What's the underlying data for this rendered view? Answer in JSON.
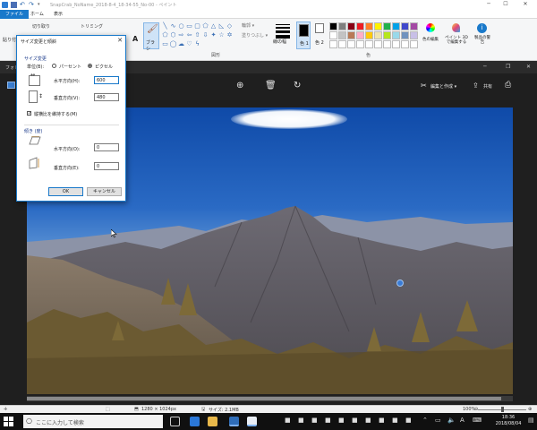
{
  "paint": {
    "title": "SnapCrab_NoName_2018-8-4_18-34-55_No-00 - ペイント",
    "tabs": [
      "ファイル",
      "ホーム",
      "表示"
    ],
    "clipboard_paste": "貼り付",
    "clipboard_cut": "切り取り",
    "image_crop": "トリミング",
    "brush_label": "ブラシ",
    "outline_label": "輪郭",
    "fill_label": "塗りつぶし",
    "size_label": "線の幅",
    "color1_label": "色 1",
    "color2_label": "色 2",
    "edit_colors_label": "色の編集",
    "paint3d_label": "ペイント 3D で編集する",
    "product_alert_label": "製品の警告",
    "group_shapes": "図形",
    "group_colors": "色",
    "palette_colors": [
      "#000000",
      "#7f7f7f",
      "#880015",
      "#ed1c24",
      "#ff7f27",
      "#fff200",
      "#22b14c",
      "#00a2e8",
      "#3f48cc",
      "#a349a4",
      "#ffffff",
      "#c3c3c3",
      "#b97a57",
      "#ffaec9",
      "#ffc90e",
      "#efe4b0",
      "#b5e61d",
      "#99d9ea",
      "#7092be",
      "#c8bfe7",
      "#ffffff",
      "#ffffff",
      "#ffffff",
      "#ffffff",
      "#ffffff",
      "#ffffff",
      "#ffffff",
      "#ffffff",
      "#ffffff",
      "#ffffff"
    ]
  },
  "photos": {
    "app_name": "フォト",
    "edit_create": "編集と作成",
    "share": "共有"
  },
  "dialog": {
    "title": "サイズ変更と傾斜",
    "resize_header": "サイズ変更",
    "unit_label": "単位(B):",
    "percent_option": "パーセント",
    "pixel_option": "ピクセル",
    "unit_selected": "ピクセル",
    "horizontal_label": "水平方向(H):",
    "horizontal_value": "600",
    "vertical_label": "垂直方向(V):",
    "vertical_value": "480",
    "keep_aspect_label": "縦横比を維持する(M)",
    "keep_aspect_checked": true,
    "skew_header": "傾き (度)",
    "skew_horizontal_label": "水平方向(O):",
    "skew_horizontal_value": "0",
    "skew_vertical_label": "垂直方向(E):",
    "skew_vertical_value": "0",
    "ok_label": "OK",
    "cancel_label": "キャンセル"
  },
  "status": {
    "dimensions": "1280 × 1024px",
    "file_size": "サイズ: 2.1MB",
    "zoom": "100%"
  },
  "taskbar": {
    "search_placeholder": "ここに入力して検索",
    "time": "18:36",
    "date": "2018/08/04"
  }
}
